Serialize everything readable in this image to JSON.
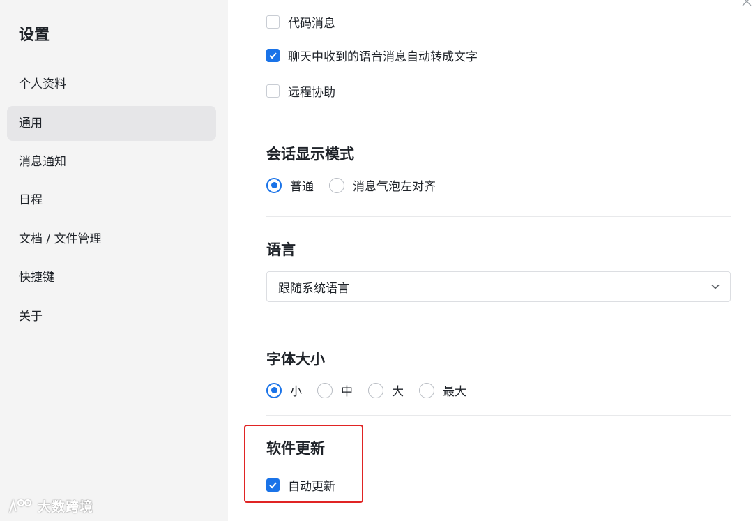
{
  "sidebar": {
    "title": "设置",
    "items": [
      {
        "label": "个人资料",
        "active": false
      },
      {
        "label": "通用",
        "active": true
      },
      {
        "label": "消息通知",
        "active": false
      },
      {
        "label": "日程",
        "active": false
      },
      {
        "label": "文档 / 文件管理",
        "active": false
      },
      {
        "label": "快捷键",
        "active": false
      },
      {
        "label": "关于",
        "active": false
      }
    ],
    "watermark": "大数跨境"
  },
  "main": {
    "top_options": [
      {
        "label": "代码消息",
        "checked": false
      },
      {
        "label": "聊天中收到的语音消息自动转成文字",
        "checked": true
      },
      {
        "label": "远程协助",
        "checked": false
      }
    ],
    "conversation_mode": {
      "title": "会话显示模式",
      "options": [
        {
          "label": "普通",
          "selected": true
        },
        {
          "label": "消息气泡左对齐",
          "selected": false
        }
      ]
    },
    "language": {
      "title": "语言",
      "selected": "跟随系统语言"
    },
    "font_size": {
      "title": "字体大小",
      "options": [
        {
          "label": "小",
          "selected": true
        },
        {
          "label": "中",
          "selected": false
        },
        {
          "label": "大",
          "selected": false
        },
        {
          "label": "最大",
          "selected": false
        }
      ]
    },
    "software_update": {
      "title": "软件更新",
      "auto_update_label": "自动更新",
      "auto_update_checked": true
    }
  },
  "colors": {
    "accent": "#1a73e8",
    "sidebar_bg": "#f4f4f4",
    "active_item_bg": "#e6e6e8",
    "highlight": "#e02424"
  }
}
